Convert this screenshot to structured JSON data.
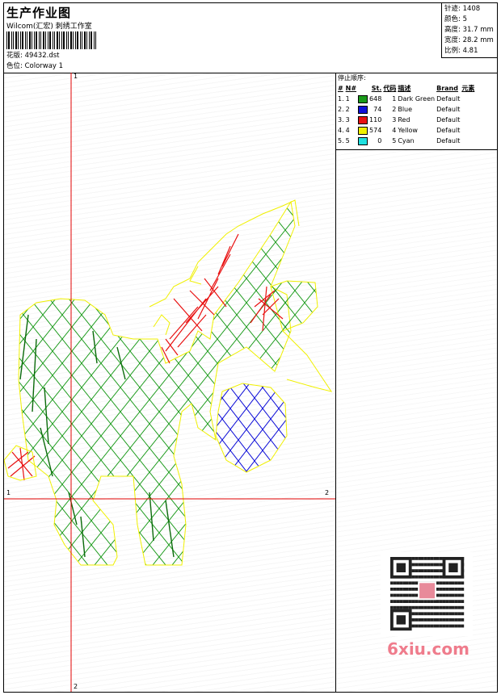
{
  "header": {
    "title": "生产作业图",
    "subtitle": "Wilcom(汇宏) 刺绣工作室",
    "design_label": "花版:",
    "design_value": "49432.dst",
    "colorway_label": "色位:",
    "colorway_value": "Colorway 1"
  },
  "specs": {
    "stitches": "针迹: 1408",
    "colors": "颜色: 5",
    "height": "高度: 31.7 mm",
    "width": "宽度: 28.2 mm",
    "scale": "比例: 4.81"
  },
  "panel": {
    "title": "停止顺序:",
    "columns": [
      "#",
      "N#",
      "St.",
      "代码",
      "描述",
      "Brand",
      "元素"
    ],
    "rows": [
      {
        "idx": "1.",
        "n": "1",
        "color": "#1a9a1a",
        "st": "648",
        "code": "1",
        "desc": "Dark Green",
        "brand": "Default"
      },
      {
        "idx": "2.",
        "n": "2",
        "color": "#1010d8",
        "st": "74",
        "code": "2",
        "desc": "Blue",
        "brand": "Default"
      },
      {
        "idx": "3.",
        "n": "3",
        "color": "#e81010",
        "st": "110",
        "code": "3",
        "desc": "Red",
        "brand": "Default"
      },
      {
        "idx": "4.",
        "n": "4",
        "color": "#f0f000",
        "st": "574",
        "code": "4",
        "desc": "Yellow",
        "brand": "Default"
      },
      {
        "idx": "5.",
        "n": "5",
        "color": "#20e0e0",
        "st": "0",
        "code": "5",
        "desc": "Cyan",
        "brand": "Default"
      }
    ]
  },
  "axes": {
    "x_start": "1",
    "x_end": "2",
    "y_start": "1",
    "y_end": "2"
  },
  "watermark": "6xiu.com",
  "colors": {
    "green": "#1a9a1a",
    "blue": "#1010d8",
    "red": "#e81010",
    "yellow": "#f0f000",
    "axis": "#e00000"
  }
}
